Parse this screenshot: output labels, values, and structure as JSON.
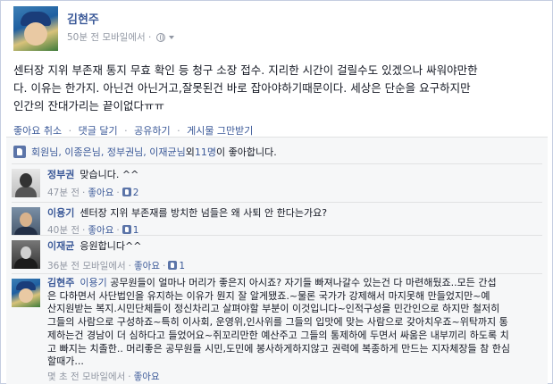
{
  "post": {
    "author": "김현주",
    "meta": "50분 전 모바일에서 ·",
    "lines": [
      "센터장 지위 부존재 통지 무효 확인 등 청구 소장 접수. 지리한 시간이 걸릴수도 있겠으나 싸워야만한",
      "다. 이유는 한가지. 아닌건 아닌거고,잘못된건 바로 잡아야하기때문이다. 세상은 단순을 요구하지만",
      "인간의 잔대가리는 끝이없다ㅠㅠ"
    ]
  },
  "actions": {
    "like": "좋아요 취소",
    "comment": "댓글 달기",
    "share": "공유하기",
    "unfollow": "게시물 그만받기",
    "sep": "·"
  },
  "likes": {
    "names": "회원님, 이종은님, 정부권님, 이재균님",
    "connector": " 외 ",
    "others": "11명",
    "suffix": "이 좋아합니다."
  },
  "comments": [
    {
      "name": "정부권",
      "text": "맞습니다. ^^",
      "time": "47분 전",
      "like_label": "좋아요",
      "like_count": "2"
    },
    {
      "name": "이용기",
      "text": "센터장 지위 부존재를 방치한 넘들은 왜 사퇴 안 한다는가요?",
      "time": "40분 전",
      "like_label": "좋아요",
      "like_count": "1"
    },
    {
      "name": "이재균",
      "text": "응원합니다^^",
      "time": "36분 전 모바일에서",
      "like_label": "좋아요",
      "like_count": "1"
    },
    {
      "name": "김현주",
      "mention": "이용기",
      "lines": [
        "공무원들이 얼마나 머리가 좋은지 아시죠? 자기들 빠져나갈수 있는건 다 마련해뒀죠..모든 간섭",
        "은 다하면서 사단법인을 유지하는 이유가 뭔지 잘 알게됐죠.~물론 국가가 강제해서 마지못해 만들었지만~예",
        "산지원받는 복지.시민단체들이 정신차리고 살펴야할 부분이 이것입니다~인적구성을 민간인으로 하지만 철저히",
        "그들의 사람으로 구성하죠~특히 이사회, 운영위,인사위를 그들의 입맛에 맞는 사람으로 갖아치우죠~위탁까지 통",
        "제하는건 경남이 더 심하다고 들었어요~쥐꼬리만한 예산주고 그들의 통제하에 두면서 싸움은 내부끼리 하도록 치",
        "고 빠지는 치졸한.. 머리좋은 공무원들 시민,도민에 봉사하게하지않고 권력에 복종하게 만드는 지자체장들 참 한심",
        "할때가..."
      ],
      "time": "몇 초 전 모바일에서",
      "like_label": "좋아요"
    }
  ]
}
